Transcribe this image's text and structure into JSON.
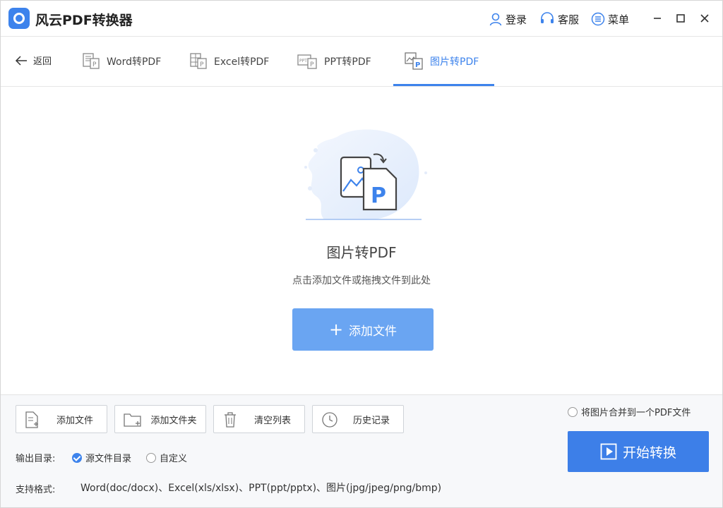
{
  "app": {
    "title": "风云PDF转换器"
  },
  "titlebar": {
    "login": "登录",
    "service": "客服",
    "menu": "菜单"
  },
  "nav": {
    "back": "返回",
    "tabs": [
      {
        "label": "Word转PDF"
      },
      {
        "label": "Excel转PDF"
      },
      {
        "label": "PPT转PDF"
      },
      {
        "label": "图片转PDF",
        "active": true
      }
    ]
  },
  "drop": {
    "title": "图片转PDF",
    "subtitle": "点击添加文件或拖拽文件到此处",
    "add_button": "添加文件"
  },
  "toolbar": {
    "add_file": "添加文件",
    "add_folder": "添加文件夹",
    "clear_list": "清空列表",
    "history": "历史记录"
  },
  "options": {
    "merge_label": "将图片合并到一个PDF文件",
    "merge_checked": false,
    "output_label": "输出目录:",
    "output_source": "源文件目录",
    "output_custom": "自定义",
    "output_selected": "源文件目录",
    "formats_label": "支持格式:",
    "formats_value": "Word(doc/docx)、Excel(xls/xlsx)、PPT(ppt/pptx)、图片(jpg/jpeg/png/bmp)"
  },
  "start_button": "开始转换",
  "colors": {
    "accent": "#3d83ec",
    "button_light": "#6aa5f2"
  }
}
